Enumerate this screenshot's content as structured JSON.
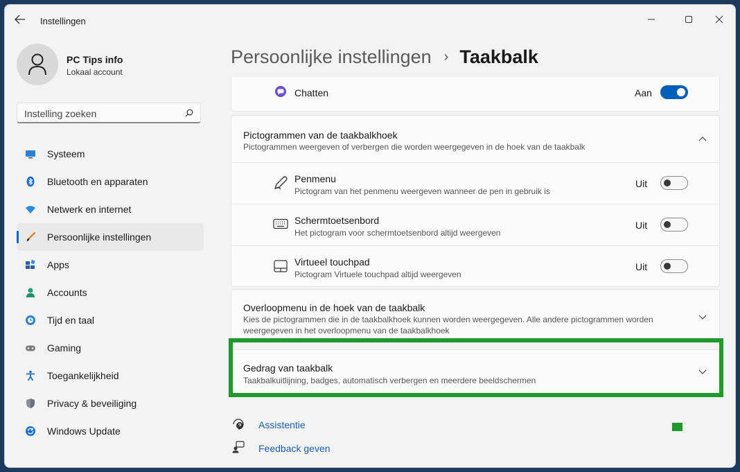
{
  "window": {
    "title": "Instellingen"
  },
  "profile": {
    "name": "PC Tips info",
    "account": "Lokaal account"
  },
  "search": {
    "placeholder": "Instelling zoeken"
  },
  "sidebar": {
    "items": [
      {
        "label": "Systeem",
        "icon": "system-icon",
        "active": false
      },
      {
        "label": "Bluetooth en apparaten",
        "icon": "bluetooth-icon",
        "active": false
      },
      {
        "label": "Netwerk en internet",
        "icon": "wifi-icon",
        "active": false
      },
      {
        "label": "Persoonlijke instellingen",
        "icon": "brush-icon",
        "active": true
      },
      {
        "label": "Apps",
        "icon": "apps-icon",
        "active": false
      },
      {
        "label": "Accounts",
        "icon": "accounts-icon",
        "active": false
      },
      {
        "label": "Tijd en taal",
        "icon": "time-language-icon",
        "active": false
      },
      {
        "label": "Gaming",
        "icon": "gamepad-icon",
        "active": false
      },
      {
        "label": "Toegankelijkheid",
        "icon": "accessibility-icon",
        "active": false
      },
      {
        "label": "Privacy & beveiliging",
        "icon": "shield-icon",
        "active": false
      },
      {
        "label": "Windows Update",
        "icon": "update-icon",
        "active": false
      }
    ]
  },
  "header": {
    "parent": "Persoonlijke instellingen",
    "separator": "›",
    "current": "Taakbalk"
  },
  "content": {
    "chat": {
      "label": "Chatten",
      "state": "Aan",
      "on": true
    },
    "corner_icons": {
      "title": "Pictogrammen van de taakbalkhoek",
      "description": "Pictogrammen weergeven of verbergen die worden weergegeven in de hoek van de taakbalk",
      "items": [
        {
          "title": "Penmenu",
          "description": "Pictogram van het penmenu weergeven wanneer de pen in gebruik is",
          "state": "Uit",
          "on": false,
          "icon": "pen-icon"
        },
        {
          "title": "Schermtoetsenbord",
          "description": "Het pictogram voor schermtoetsenbord altijd weergeven",
          "state": "Uit",
          "on": false,
          "icon": "keyboard-icon"
        },
        {
          "title": "Virtueel touchpad",
          "description": "Pictogram Virtuele touchpad altijd weergeven",
          "state": "Uit",
          "on": false,
          "icon": "touchpad-icon"
        }
      ]
    },
    "overflow": {
      "title": "Overloopmenu in de hoek van de taakbalk",
      "description": "Kies de pictogrammen die in de taakbalkhoek kunnen worden weergegeven. Alle andere pictogrammen worden weergegeven in het overloopmenu van de taakbalkhoek"
    },
    "behavior": {
      "title": "Gedrag van taakbalk",
      "description": "Taakbalkuitlijning, badges, automatisch verbergen en meerdere beeldschermen"
    }
  },
  "links": {
    "help": "Assistentie",
    "feedback": "Feedback geven"
  },
  "colors": {
    "accent": "#005fb8",
    "highlight": "#1d9a2a"
  }
}
